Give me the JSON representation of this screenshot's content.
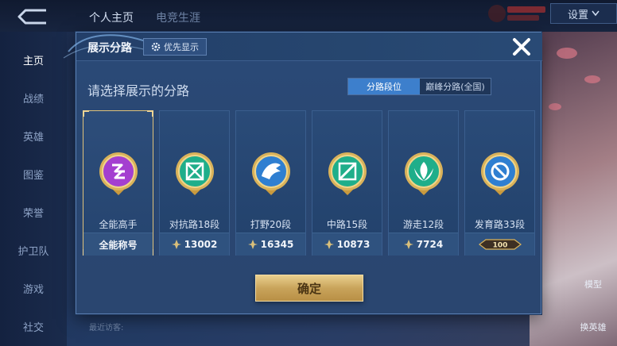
{
  "background": {
    "top_tabs": [
      "个人主页",
      "电竞生涯"
    ],
    "sidebar_items": [
      "主页",
      "战绩",
      "英雄",
      "图鉴",
      "荣誉",
      "护卫队",
      "游戏",
      "社交"
    ],
    "active_sidebar_index": 0,
    "settings_label": "设置",
    "right_labels": [
      "模型",
      "换英雄"
    ],
    "visitor_label": "最近访客:"
  },
  "dialog": {
    "title": "展示分路",
    "priority_button": "优先显示",
    "prompt": "请选择展示的分路",
    "segments": [
      "分路段位",
      "巅峰分路(全国)"
    ],
    "active_segment": 0,
    "confirm_label": "确定",
    "lanes": [
      {
        "name": "全能高手",
        "value": "全能称号",
        "icon": "all-round-badge-icon",
        "color": "#a43fd0",
        "selected": true
      },
      {
        "name": "对抗路18段",
        "value": "13002",
        "icon": "clash-lane-badge-icon",
        "color": "#1fae8a",
        "selected": false
      },
      {
        "name": "打野20段",
        "value": "16345",
        "icon": "jungle-badge-icon",
        "color": "#2f7fd1",
        "selected": false
      },
      {
        "name": "中路15段",
        "value": "10873",
        "icon": "mid-lane-badge-icon",
        "color": "#1fae8a",
        "selected": false
      },
      {
        "name": "游走12段",
        "value": "7724",
        "icon": "roam-badge-icon",
        "color": "#1fae8a",
        "selected": false
      },
      {
        "name": "发育路33段",
        "value": "100",
        "icon": "farm-lane-badge-icon",
        "color": "#2f7fd1",
        "selected": false
      }
    ]
  }
}
